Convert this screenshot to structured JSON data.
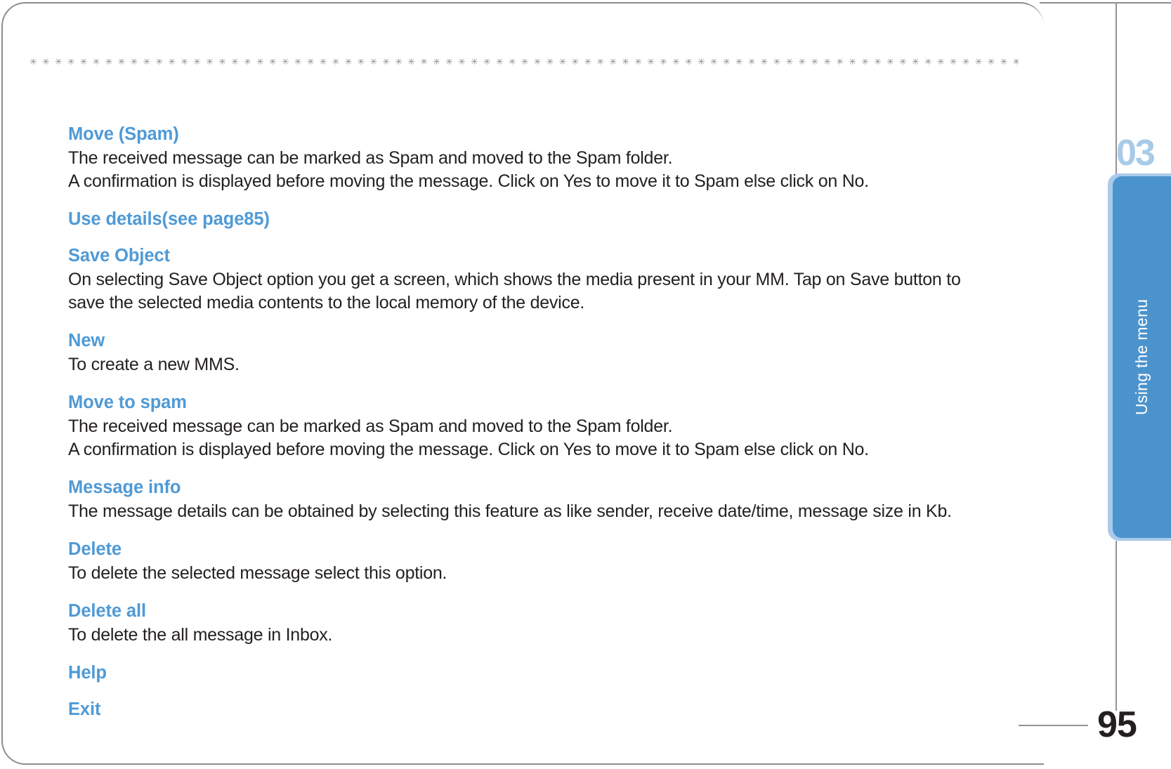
{
  "page": {
    "number": "95",
    "chapter_number": "03",
    "chapter_label": "Using the menu",
    "rule_glyphs": "✳✳✳✳✳✳✳✳✳✳✳✳✳✳✳✳✳✳✳✳✳✳✳✳✳✳✳✳✳✳✳✳✳✳✳✳✳✳✳✳✳✳✳✳✳✳✳✳✳✳✳✳✳✳✳✳✳✳✳✳✳✳✳✳✳✳✳✳✳✳✳✳✳✳✳✳✳✳✳✳✳✳✳✳✳✳✳✳✳✳✳✳✳✳✳✳✳✳✳✳✳✳✳✳✳✳✳✳✳✳✳✳✳✳✳✳✳✳✳✳✳✳✳✳✳✳✳✳✳✳✳✳✳✳✳✳✳✳✳✳✳✳✳✳✳✳✳✳✳✳✳✳✳✳✳✳✳✳",
    "accent_color": "#4f9ad6",
    "tab_color": "#4b93cd",
    "tab_outline_color": "#a9cbe9",
    "text_color": "#231f20",
    "rule_color": "#8e8e92"
  },
  "sections": [
    {
      "heading": "Move (Spam)",
      "lines": [
        "The received message can be marked as Spam and moved to the Spam folder.",
        "A confirmation is displayed before moving the message. Click on Yes to move it to Spam else click on No."
      ]
    },
    {
      "heading": "Use details(see page85)",
      "lines": []
    },
    {
      "heading": "Save Object",
      "lines": [
        "On selecting Save Object option you get a screen, which shows the media present in your MM. Tap on Save button to",
        "save the selected media contents to the local memory of the device."
      ]
    },
    {
      "heading": "New",
      "lines": [
        "To create a new MMS."
      ]
    },
    {
      "heading": "Move to spam",
      "lines": [
        "The received message can be marked as Spam and moved to the Spam folder.",
        "A confirmation is displayed before moving the message. Click on Yes to move it to Spam else click on No."
      ]
    },
    {
      "heading": "Message info",
      "lines": [
        "The message details can be obtained by selecting this feature as like sender, receive date/time, message size in Kb."
      ]
    },
    {
      "heading": "Delete",
      "lines": [
        "To delete the selected message select this option."
      ]
    },
    {
      "heading": "Delete all",
      "lines": [
        "To delete the all message in Inbox."
      ]
    },
    {
      "heading": "Help",
      "lines": []
    },
    {
      "heading": "Exit",
      "lines": []
    }
  ]
}
